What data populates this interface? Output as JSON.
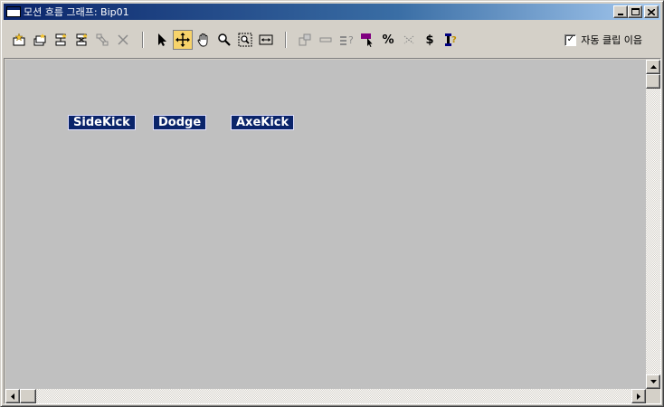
{
  "window": {
    "title": "모션 흐름 그래프: Bip01"
  },
  "toolbar": {
    "auto_loop_label": "자동 클립 이음",
    "auto_loop_checked": true,
    "tools": [
      {
        "icon": "create-clip-icon"
      },
      {
        "icon": "open-clips-icon"
      },
      {
        "icon": "add-transition-icon"
      },
      {
        "icon": "add-random-transition-icon"
      },
      {
        "icon": "show-transitions-icon"
      },
      {
        "icon": "delete-icon"
      },
      {
        "icon": "select-arrow-icon"
      },
      {
        "icon": "move-icon"
      },
      {
        "icon": "pan-hand-icon"
      },
      {
        "icon": "zoom-icon"
      },
      {
        "icon": "zoom-region-icon"
      },
      {
        "icon": "fit-width-icon"
      },
      {
        "icon": "clip-properties-icon"
      },
      {
        "icon": "transition-icon"
      },
      {
        "icon": "help-query-icon"
      },
      {
        "icon": "color-select-icon"
      },
      {
        "icon": "percent-icon"
      },
      {
        "icon": "random-icon"
      },
      {
        "icon": "dollar-icon"
      },
      {
        "icon": "script-icon"
      }
    ],
    "glyphs": {
      "percent": "%",
      "dollar": "$",
      "check": "✓"
    }
  },
  "graph": {
    "nodes": [
      {
        "label": "SideKick"
      },
      {
        "label": "Dodge"
      },
      {
        "label": "AxeKick"
      }
    ]
  },
  "colors": {
    "title_bar": "#0a246a",
    "node_bg": "#0a246a",
    "node_text": "#ffffff",
    "canvas_bg": "#c0c0c0",
    "active_tool": "#f7d36a"
  }
}
